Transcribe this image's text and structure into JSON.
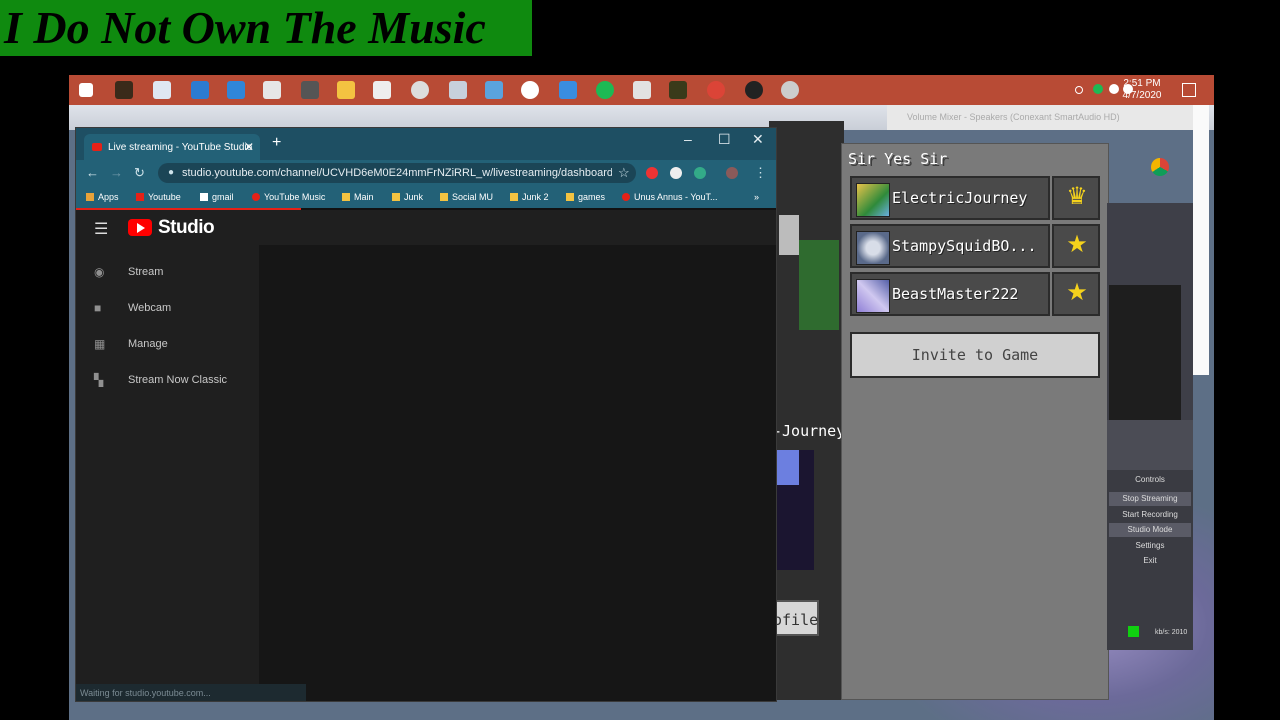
{
  "overlay": {
    "text": "I Do Not Own The Music"
  },
  "taskbar": {
    "time": "2:51 PM",
    "date": "4/7/2020"
  },
  "browser": {
    "tab_title": "Live streaming - YouTube Studio",
    "url": "studio.youtube.com/channel/UCVHD6eM0E24mmFrNZiRRL_w/livestreaming/dashboard?v...",
    "bookmarks": [
      "Apps",
      "Youtube",
      "gmail",
      "YouTube Music",
      "Main",
      "Junk",
      "Social MU",
      "Junk 2",
      "games",
      "Unus Annus - YouT..."
    ],
    "status": "Waiting for studio.youtube.com..."
  },
  "studio": {
    "logo_text": "Studio",
    "nav": [
      "Stream",
      "Webcam",
      "Manage",
      "Stream Now Classic"
    ]
  },
  "minecraft": {
    "panel_title": "Sir Yes Sir",
    "friends": [
      {
        "name": "ElectricJourney",
        "badge": "crown"
      },
      {
        "name": "StampySquidBO...",
        "badge": "star"
      },
      {
        "name": "BeastMaster222",
        "badge": "star"
      }
    ],
    "invite_label": "Invite to Game",
    "name_tag": "-Journey",
    "profile_btn": "ofile"
  },
  "obs": {
    "controls_title": "Controls",
    "buttons": [
      "Stop Streaming",
      "Start Recording",
      "Studio Mode",
      "Settings",
      "Exit"
    ],
    "kbps": "kb/s: 2010"
  },
  "volume_mixer": {
    "title": "Volume Mixer - Speakers (Conexant SmartAudio HD)"
  },
  "colors": {
    "taskbar": "#b84b35",
    "chrome_frame": "#236177",
    "yt_red": "#ff0000",
    "overlay_bg": "#0f8a0f",
    "live_green": "#10d010"
  }
}
